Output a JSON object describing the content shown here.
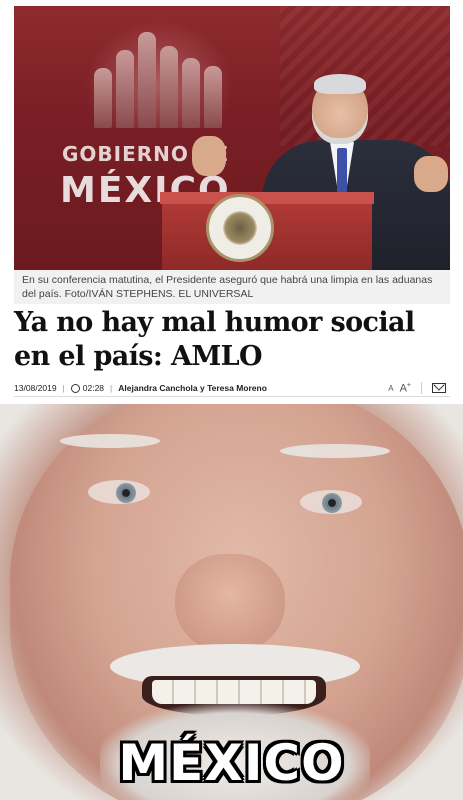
{
  "news": {
    "photo": {
      "backdrop_line1": "GOBIERNO DE",
      "backdrop_line2": "MÉXICO"
    },
    "caption": "En su conferencia matutina, el Presidente aseguró que habrá una limpia en las aduanas del país. Foto/IVÁN STEPHENS. EL UNIVERSAL",
    "headline": "Ya no hay mal humor social en el país: AMLO",
    "meta": {
      "date": "13/08/2019",
      "time": "02:28",
      "authors": "Alejandra Canchola y Teresa Moreno",
      "font_small": "A",
      "font_large": "A",
      "font_plus": "+"
    }
  },
  "meme": {
    "caption": "MÉXICO"
  },
  "colors": {
    "backdrop_red": "#7a1f25",
    "headline_text": "#111111",
    "caption_bg": "#f1f1f1"
  },
  "icons": [
    "clock-icon",
    "mail-icon",
    "font-decrease-icon",
    "font-increase-icon",
    "seal-icon"
  ]
}
